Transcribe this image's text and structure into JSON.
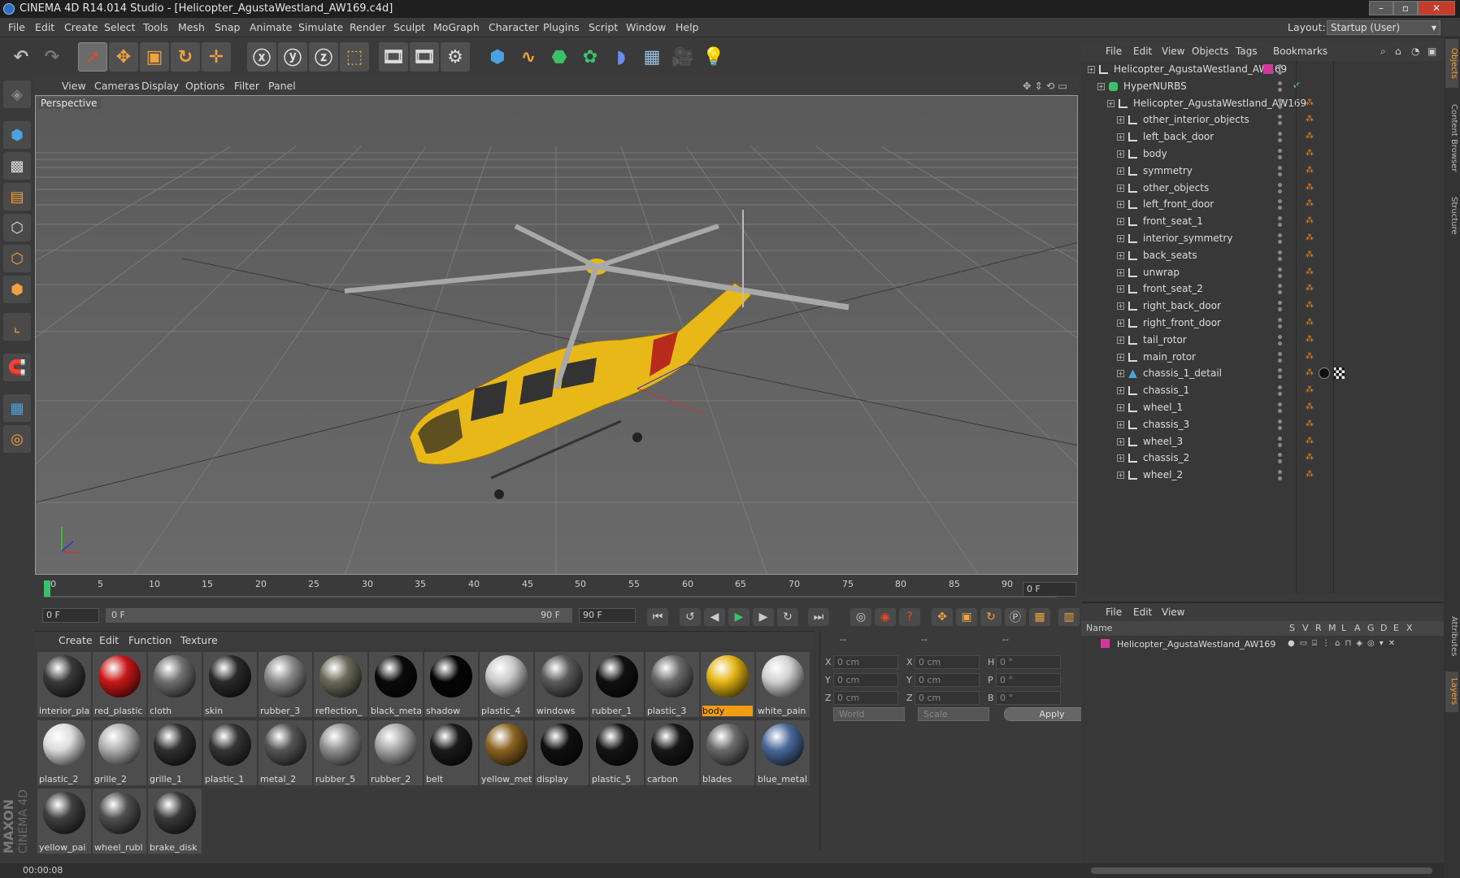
{
  "window": {
    "title": "CINEMA 4D R14.014 Studio - [Helicopter_AgustaWestland_AW169.c4d]",
    "controls": [
      "–",
      "▫",
      "✕"
    ]
  },
  "menubar": {
    "items": [
      "File",
      "Edit",
      "Create",
      "Select",
      "Tools",
      "Mesh",
      "Snap",
      "Animate",
      "Simulate",
      "Render",
      "Sculpt",
      "MoGraph",
      "Character",
      "Plugins",
      "Script",
      "Window",
      "Help"
    ],
    "layout_label": "Layout:",
    "layout_value": "Startup (User)"
  },
  "viewport": {
    "menu": [
      "View",
      "Cameras",
      "Display",
      "Options",
      "Filter",
      "Panel"
    ],
    "label": "Perspective"
  },
  "timeline": {
    "ticks": [
      "0",
      "5",
      "10",
      "15",
      "20",
      "25",
      "30",
      "35",
      "40",
      "45",
      "50",
      "55",
      "60",
      "65",
      "70",
      "75",
      "80",
      "85",
      "90"
    ],
    "current_frame": "0 F",
    "start_field": "0 F",
    "range_start": "0 F",
    "range_end": "90 F",
    "end_field": "90 F"
  },
  "materials": {
    "menu": [
      "Create",
      "Edit",
      "Function",
      "Texture"
    ],
    "items": [
      {
        "name": "interior_pla",
        "color": "#3a3a3a"
      },
      {
        "name": "red_plastic",
        "color": "#c81818"
      },
      {
        "name": "cloth",
        "color": "#707070"
      },
      {
        "name": "skin",
        "color": "#2a2a2a"
      },
      {
        "name": "rubber_3",
        "color": "#8a8a8a"
      },
      {
        "name": "reflection_",
        "color": "#6a6a5a"
      },
      {
        "name": "black_meta",
        "color": "#0a0a0a"
      },
      {
        "name": "shadow",
        "color": "#050505"
      },
      {
        "name": "plastic_4",
        "color": "#c8c8c8"
      },
      {
        "name": "windows",
        "color": "#5a5a5a"
      },
      {
        "name": "rubber_1",
        "color": "#111111"
      },
      {
        "name": "plastic_3",
        "color": "#6a6a6a"
      },
      {
        "name": "body",
        "color": "#e5b615"
      },
      {
        "name": "white_pain",
        "color": "#d0d0d0"
      },
      {
        "name": "plastic_2",
        "color": "#dcdcdc"
      },
      {
        "name": "grille_2",
        "color": "#b0b0b0"
      },
      {
        "name": "grille_1",
        "color": "#303030"
      },
      {
        "name": "plastic_1",
        "color": "#353535"
      },
      {
        "name": "metal_2",
        "color": "#555555"
      },
      {
        "name": "rubber_5",
        "color": "#909090"
      },
      {
        "name": "rubber_2",
        "color": "#a8a8a8"
      },
      {
        "name": "belt",
        "color": "#1a1a1a"
      },
      {
        "name": "yellow_met",
        "color": "#8a6420"
      },
      {
        "name": "display",
        "color": "#101010"
      },
      {
        "name": "plastic_5",
        "color": "#151515"
      },
      {
        "name": "carbon",
        "color": "#181818"
      },
      {
        "name": "blades",
        "color": "#6a6a6a"
      },
      {
        "name": "blue_metal",
        "color": "#4a6a9a"
      },
      {
        "name": "yellow_pai",
        "color": "#404040"
      },
      {
        "name": "wheel_rubl",
        "color": "#505050"
      },
      {
        "name": "brake_disk",
        "color": "#3a3a3a"
      }
    ],
    "active": "body"
  },
  "coords": {
    "header": [
      "--",
      "--",
      "--"
    ],
    "rows": [
      {
        "a": "X",
        "av": "0 cm",
        "b": "X",
        "bv": "0 cm",
        "c": "H",
        "cv": "0 °"
      },
      {
        "a": "Y",
        "av": "0 cm",
        "b": "Y",
        "bv": "0 cm",
        "c": "P",
        "cv": "0 °"
      },
      {
        "a": "Z",
        "av": "0 cm",
        "b": "Z",
        "bv": "0 cm",
        "c": "B",
        "cv": "0 °"
      }
    ],
    "space": "World",
    "mode": "Scale",
    "apply": "Apply"
  },
  "objects": {
    "menu": [
      "File",
      "Edit",
      "View",
      "Objects",
      "Tags",
      "Bookmarks"
    ],
    "items": [
      {
        "name": "Helicopter_AgustaWestland_AW169",
        "level": 0
      },
      {
        "name": "HyperNURBS",
        "level": 1
      },
      {
        "name": "Helicopter_AgustaWestland_AW169",
        "level": 2
      },
      {
        "name": "other_interior_objects",
        "level": 3
      },
      {
        "name": "left_back_door",
        "level": 3
      },
      {
        "name": "body",
        "level": 3
      },
      {
        "name": "symmetry",
        "level": 3
      },
      {
        "name": "other_objects",
        "level": 3
      },
      {
        "name": "left_front_door",
        "level": 3
      },
      {
        "name": "front_seat_1",
        "level": 3
      },
      {
        "name": "interior_symmetry",
        "level": 3
      },
      {
        "name": "back_seats",
        "level": 3
      },
      {
        "name": "unwrap",
        "level": 3
      },
      {
        "name": "front_seat_2",
        "level": 3
      },
      {
        "name": "right_back_door",
        "level": 3
      },
      {
        "name": "right_front_door",
        "level": 3
      },
      {
        "name": "tail_rotor",
        "level": 3
      },
      {
        "name": "main_rotor",
        "level": 3
      },
      {
        "name": "chassis_1_detail",
        "level": 3
      },
      {
        "name": "chassis_1",
        "level": 3
      },
      {
        "name": "wheel_1",
        "level": 3
      },
      {
        "name": "chassis_3",
        "level": 3
      },
      {
        "name": "wheel_3",
        "level": 3
      },
      {
        "name": "chassis_2",
        "level": 3
      },
      {
        "name": "wheel_2",
        "level": 3
      }
    ]
  },
  "layers": {
    "menu": [
      "File",
      "Edit",
      "View"
    ],
    "columns": [
      "Name",
      "S",
      "V",
      "R",
      "M",
      "L",
      "A",
      "G",
      "D",
      "E",
      "X"
    ],
    "items": [
      "Helicopter_AgustaWestland_AW169"
    ]
  },
  "right_tabs": [
    "Objects",
    "Content Browser",
    "Structure",
    "Attributes",
    "Layers"
  ],
  "status": {
    "time": "00:00:08"
  },
  "brand": {
    "line1": "MAXON",
    "line2": "CINEMA 4D"
  },
  "colors": {
    "accent": "#f09d16",
    "body_yellow": "#e5b615",
    "layer_pink": "#cc3a9a"
  }
}
